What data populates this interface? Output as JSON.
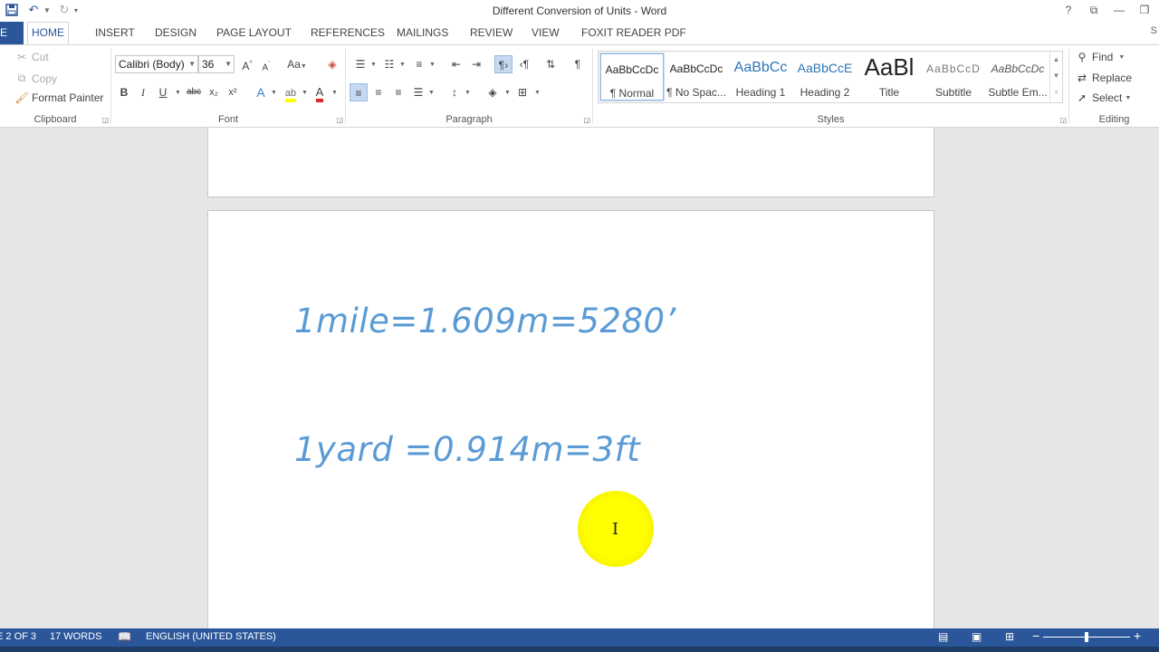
{
  "window": {
    "title": "Different Conversion of Units - Word"
  },
  "qat": {
    "save_icon": "save-icon",
    "undo_icon": "undo-icon",
    "redo_icon": "redo-icon"
  },
  "winctrls": {
    "help": "?",
    "restore_ribbon": "⧉",
    "minimize": "—",
    "restore": "❐"
  },
  "tabs": {
    "file": "E",
    "items": [
      "HOME",
      "INSERT",
      "DESIGN",
      "PAGE LAYOUT",
      "REFERENCES",
      "MAILINGS",
      "REVIEW",
      "VIEW",
      "FOXIT READER PDF"
    ],
    "active": "HOME",
    "user_initial": "S"
  },
  "clipboard": {
    "cut": "Cut",
    "copy": "Copy",
    "format_painter": "Format Painter",
    "label": "Clipboard"
  },
  "font": {
    "family": "Calibri (Body)",
    "size": "36",
    "grow": "A",
    "shrink": "A",
    "case": "Aa",
    "bold": "B",
    "italic": "I",
    "underline": "U",
    "strike": "abc",
    "subscript": "x₂",
    "superscript": "x²",
    "label": "Font"
  },
  "paragraph": {
    "label": "Paragraph",
    "pilcrow": "¶"
  },
  "styles": {
    "label": "Styles",
    "items": [
      {
        "sample": "AaBbCcDc",
        "name": "¶ Normal"
      },
      {
        "sample": "AaBbCcDc",
        "name": "¶ No Spac..."
      },
      {
        "sample": "AaBbCc",
        "name": "Heading 1"
      },
      {
        "sample": "AaBbCcE",
        "name": "Heading 2"
      },
      {
        "sample": "AaBl",
        "name": "Title"
      },
      {
        "sample": "AaBbCcD",
        "name": "Subtitle"
      },
      {
        "sample": "AaBbCcDc",
        "name": "Subtle Em..."
      }
    ]
  },
  "editing": {
    "find": "Find",
    "replace": "Replace",
    "select": "Select",
    "label": "Editing"
  },
  "document": {
    "lines": [
      "1mile=1.609m=5280’",
      "1yard =0.914m=3ft"
    ]
  },
  "status": {
    "page": "E 2 OF 3",
    "words": "17 WORDS",
    "language": "ENGLISH (UNITED STATES)"
  }
}
